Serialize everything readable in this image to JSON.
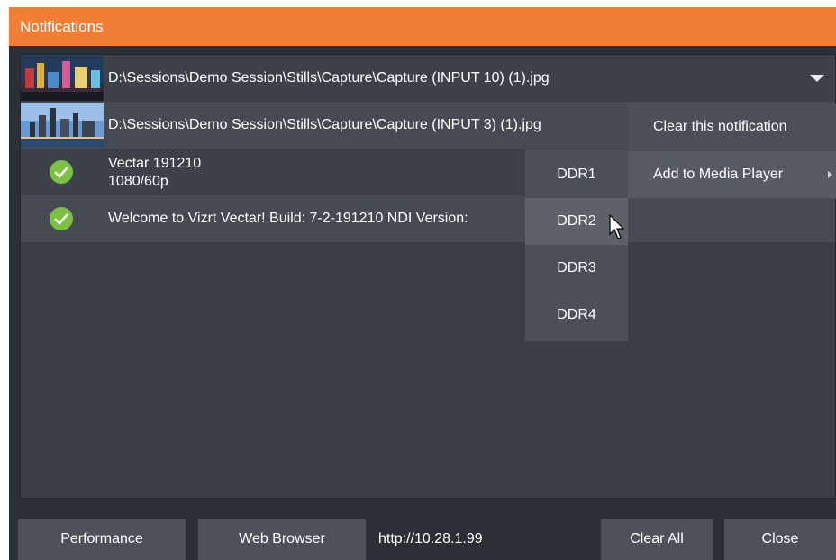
{
  "window": {
    "title": "Notifications"
  },
  "notifications": [
    {
      "text": "D:\\Sessions\\Demo Session\\Stills\\Capture\\Capture (INPUT 10) (1).jpg",
      "icon": "thumbnail-image"
    },
    {
      "text": "D:\\Sessions\\Demo Session\\Stills\\Capture\\Capture (INPUT 3) (1).jpg",
      "icon": "thumbnail-image"
    },
    {
      "line1": "Vectar 191210",
      "line2": "1080/60p",
      "icon": "check-circle-icon"
    },
    {
      "text": "Welcome to Vizrt Vectar! Build: 7-2-191210 NDI Version:",
      "icon": "check-circle-icon"
    }
  ],
  "context_menu": {
    "items": [
      {
        "label": "Clear this notification"
      },
      {
        "label": "Add to Media Player"
      }
    ]
  },
  "submenu": {
    "items": [
      {
        "label": "DDR1"
      },
      {
        "label": "DDR2"
      },
      {
        "label": "DDR3"
      },
      {
        "label": "DDR4"
      }
    ]
  },
  "footer": {
    "performance_label": "Performance",
    "web_browser_label": "Web Browser",
    "url": "http://10.28.1.99",
    "clear_all_label": "Clear All",
    "close_label": "Close"
  },
  "colors": {
    "title_bar": "#f07f35",
    "check": "#7bc142",
    "panel": "#3a3e46"
  }
}
